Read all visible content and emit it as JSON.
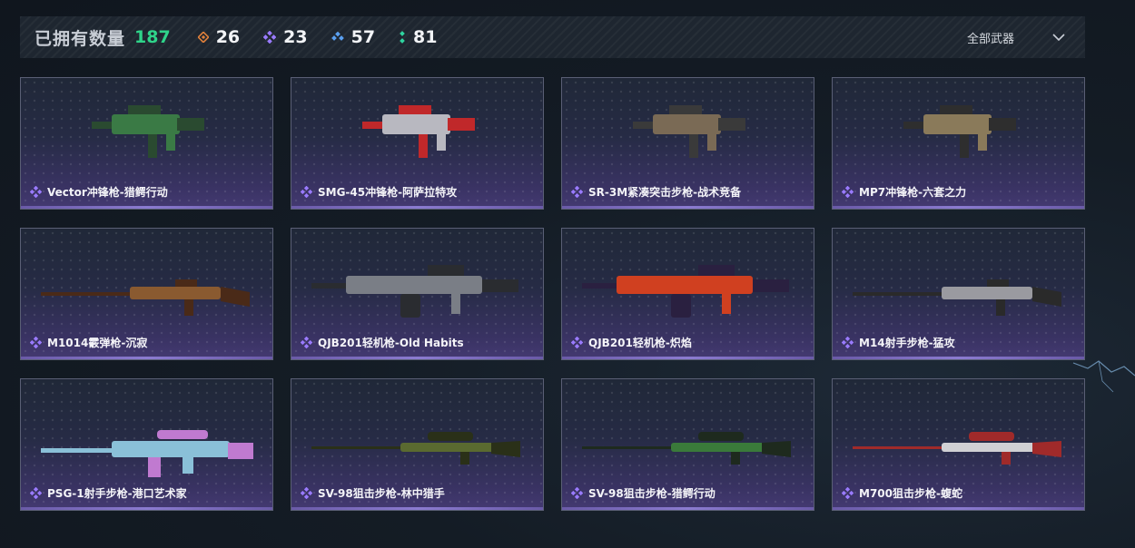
{
  "summary": {
    "owned_label": "已拥有数量",
    "owned_total": "187",
    "stats": [
      {
        "icon": "orange-rarity-icon",
        "color": "#e0803a",
        "value": "26"
      },
      {
        "icon": "purple-rarity-icon",
        "color": "#9a7bff",
        "value": "23"
      },
      {
        "icon": "blue-rarity-icon",
        "color": "#5aa0f0",
        "value": "57"
      },
      {
        "icon": "green-rarity-icon",
        "color": "#2fd4a0",
        "value": "81"
      }
    ],
    "filter_label": "全部武器",
    "filter_icon": "chevron-down-icon"
  },
  "weapons": [
    {
      "name": "Vector冲锋枪-猎鳄行动",
      "tint": "#3a7a45",
      "accent": "#2a4a30",
      "kind": "smg"
    },
    {
      "name": "SMG-45冲锋枪-阿萨拉特攻",
      "tint": "#b8b8c0",
      "accent": "#c0282a",
      "kind": "smg"
    },
    {
      "name": "SR-3M紧凑突击步枪-战术竞备",
      "tint": "#7a6a55",
      "accent": "#3a3a3a",
      "kind": "smg"
    },
    {
      "name": "MP7冲锋枪-六套之力",
      "tint": "#8a7a5a",
      "accent": "#2e2e2e",
      "kind": "smg"
    },
    {
      "name": "M1014霰弹枪-沉寂",
      "tint": "#8a5a30",
      "accent": "#4a2a18",
      "kind": "long"
    },
    {
      "name": "QJB201轻机枪-Old Habits",
      "tint": "#7a7e86",
      "accent": "#2a2c30",
      "kind": "lmg"
    },
    {
      "name": "QJB201轻机枪-炽焰",
      "tint": "#d04020",
      "accent": "#2a2040",
      "kind": "lmg"
    },
    {
      "name": "M14射手步枪-猛攻",
      "tint": "#9a9aa0",
      "accent": "#2a2a2a",
      "kind": "long"
    },
    {
      "name": "PSG-1射手步枪-港口艺术家",
      "tint": "#8ac0d8",
      "accent": "#c07ad0",
      "kind": "dmr"
    },
    {
      "name": "SV-98狙击步枪-林中猎手",
      "tint": "#5a6a30",
      "accent": "#2a3018",
      "kind": "sniper"
    },
    {
      "name": "SV-98狙击步枪-猎鳄行动",
      "tint": "#3a7a3a",
      "accent": "#1e2a1e",
      "kind": "sniper"
    },
    {
      "name": "M700狙击步枪-蝮蛇",
      "tint": "#d0d0d4",
      "accent": "#a02a2a",
      "kind": "sniper"
    }
  ],
  "rarity_icon": "purple-diamond-icon"
}
